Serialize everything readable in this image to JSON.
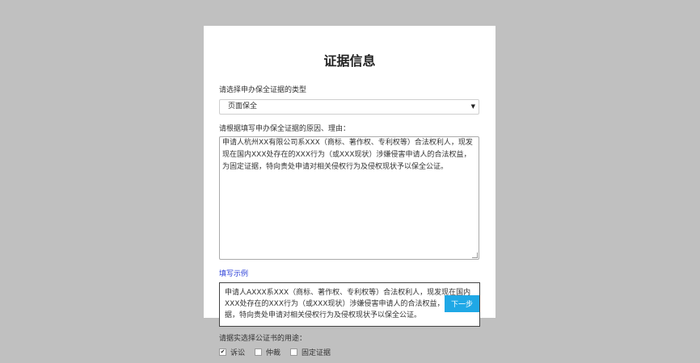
{
  "form": {
    "title": "证据信息",
    "type_label": "请选择申办保全证据的类型",
    "type_selected": "页面保全",
    "reason_label": "请根据填写申办保全证据的原因、理由：",
    "reason_text": "申请人杭州XX有限公司系XXX（商标、著作权、专利权等）合法权利人，现发现在国内XXX处存在的XXX行为（或XXX现状）涉嫌侵害申请人的合法权益，为固定证据，特向贵处申请对相关侵权行为及侵权现状予以保全公证。",
    "example_link": "填写示例",
    "example_text": "申请人AXXX系XXX（商标、著作权、专利权等）合法权利人，现发现在国内XXX处存在的XXX行为（或XXX现状）涉嫌侵害申请人的合法权益，为固定证据，特向贵处申请对相关侵权行为及侵权现状予以保全公证。",
    "next_button": "下一步",
    "usage_label": "请据实选择公证书的用途：",
    "usage_options": [
      {
        "label": "诉讼",
        "checked": true
      },
      {
        "label": "仲裁",
        "checked": false
      },
      {
        "label": "固定证据",
        "checked": false
      }
    ]
  },
  "colors": {
    "background": "#c0c0c0",
    "panel": "#ffffff",
    "accent_button": "#1fa8e6",
    "link": "#2a3ed8"
  }
}
